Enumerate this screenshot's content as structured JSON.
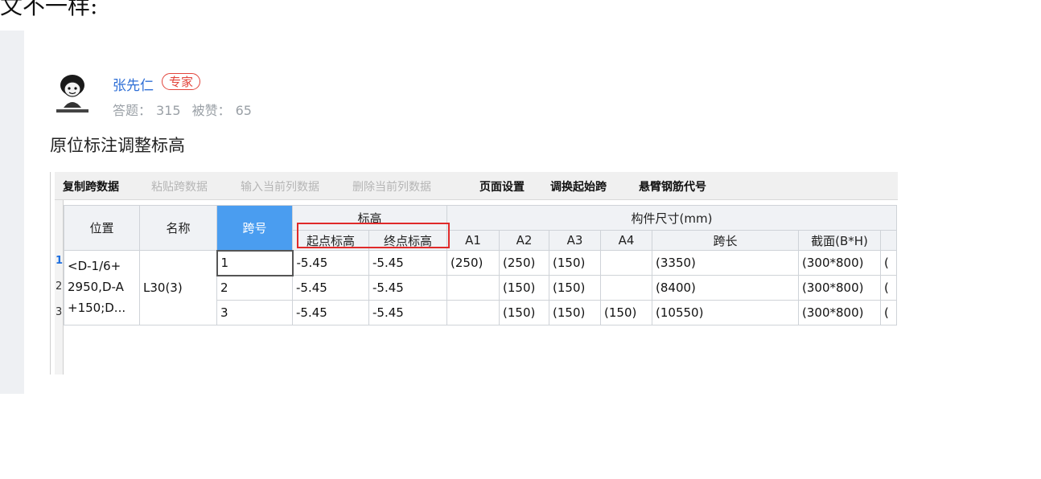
{
  "page": {
    "top_cut_text": "文不一样:"
  },
  "user": {
    "name": "张先仁",
    "badge": "专家",
    "answers_label": "答题：",
    "answers_count": "315",
    "likes_label": "被赞：",
    "likes_count": "65"
  },
  "answer": {
    "title": "原位标注调整标高"
  },
  "toolbar": {
    "items": [
      {
        "label": "复制跨数据",
        "enabled": true
      },
      {
        "label": "粘贴跨数据",
        "enabled": false
      },
      {
        "label": "输入当前列数据",
        "enabled": false
      },
      {
        "label": "删除当前列数据",
        "enabled": false
      },
      {
        "label": "页面设置",
        "enabled": true
      },
      {
        "label": "调换起始跨",
        "enabled": true
      },
      {
        "label": "悬臂钢筋代号",
        "enabled": true
      }
    ]
  },
  "table": {
    "headers": {
      "position": "位置",
      "name": "名称",
      "span_no": "跨号",
      "elevation_group": "标高",
      "start_elev": "起点标高",
      "end_elev": "终点标高",
      "size_group": "构件尺寸(mm)",
      "a1": "A1",
      "a2": "A2",
      "a3": "A3",
      "a4": "A4",
      "span_length": "跨长",
      "section": "截面(B*H)"
    },
    "row_numbers": [
      "1",
      "2",
      "3"
    ],
    "position_value": "<D-1/6+ 2950,D-A +150;D...",
    "name_value": "L30(3)",
    "rows": [
      {
        "span": "1",
        "start": "-5.45",
        "end": "-5.45",
        "a1": "(250)",
        "a2": "(250)",
        "a3": "(150)",
        "a4": "",
        "len": "(3350)",
        "sec": "(300*800)",
        "extra": "("
      },
      {
        "span": "2",
        "start": "-5.45",
        "end": "-5.45",
        "a1": "",
        "a2": "(150)",
        "a3": "(150)",
        "a4": "",
        "len": "(8400)",
        "sec": "(300*800)",
        "extra": "("
      },
      {
        "span": "3",
        "start": "-5.45",
        "end": "-5.45",
        "a1": "",
        "a2": "(150)",
        "a3": "(150)",
        "a4": "(150)",
        "len": "(10550)",
        "sec": "(300*800)",
        "extra": "("
      }
    ]
  }
}
